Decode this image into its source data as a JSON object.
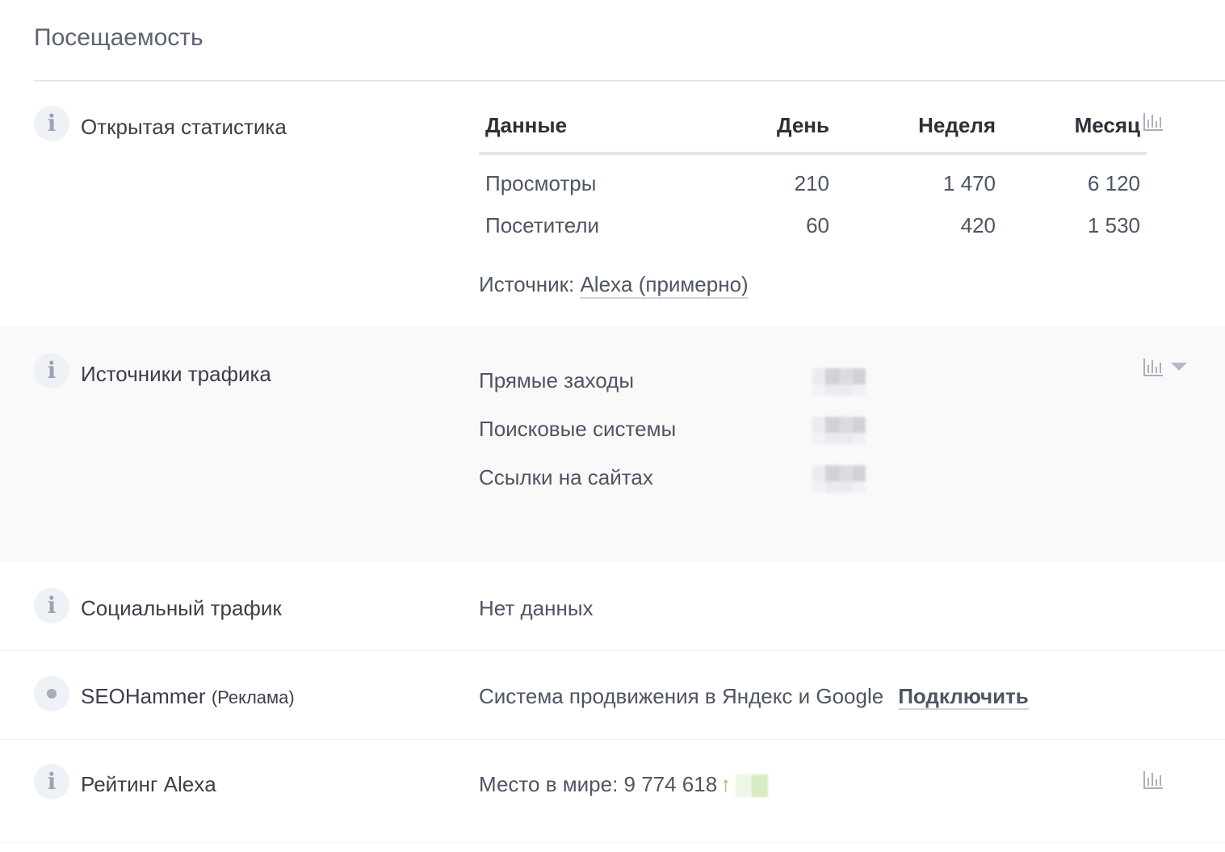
{
  "page": {
    "title": "Посещаемость"
  },
  "open_stats": {
    "label": "Открытая статистика",
    "headers": {
      "name": "Данные",
      "day": "День",
      "week": "Неделя",
      "month": "Месяц"
    },
    "rows": [
      {
        "name": "Просмотры",
        "day": "210",
        "week": "1 470",
        "month": "6 120"
      },
      {
        "name": "Посетители",
        "day": "60",
        "week": "420",
        "month": "1 530"
      }
    ],
    "source_prefix": "Источник:",
    "source_link": "Alexa (примерно)",
    "icon": "bar-chart-icon"
  },
  "traffic_sources": {
    "label": "Источники трафика",
    "items": [
      "Прямые заходы",
      "Поисковые системы",
      "Ссылки на сайтах"
    ],
    "icon": "bar-chart-icon"
  },
  "social": {
    "label": "Социальный трафик",
    "value": "Нет данных"
  },
  "seohammer": {
    "label": "SEOHammer",
    "label_note": "(Реклама)",
    "description": "Система продвижения в Яндекс и Google",
    "action": "Подключить"
  },
  "alexa_rank": {
    "label": "Рейтинг Alexa",
    "value": "Место в мире: 9 774 618",
    "trend": "↑",
    "icon": "bar-chart-icon"
  },
  "colors": {
    "text": "#3b3f4a",
    "muted": "#4e5563",
    "icon": "#a8b0bf",
    "accent_up": "#8dc55b",
    "shade": "#f9f9fa"
  }
}
